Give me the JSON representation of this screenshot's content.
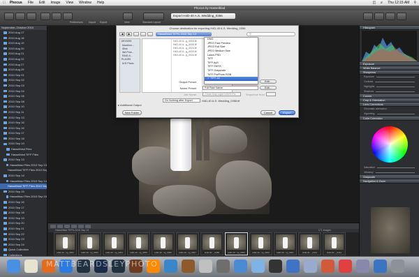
{
  "menubar": {
    "apple": "",
    "items": [
      "Phocus",
      "File",
      "Edit",
      "Image",
      "View",
      "Window",
      "Help"
    ],
    "clock": "Thu 12:15 AM"
  },
  "window": {
    "title": "Phocus by Hasselblad"
  },
  "toolbar": {
    "labels": [
      "Preferences",
      "Import",
      "Export"
    ],
    "view_label": "View",
    "mode_label": "Standard Layout",
    "export_select": "Export H4D-40 A.S. Wedding_0356"
  },
  "left_panel": {
    "header": "September–October 2010",
    "items": [
      "2010 Aug 17",
      "2010 Aug 18",
      "2010 Aug 19",
      "2010 Aug 20",
      "2010 Aug 21",
      "2010 Aug 22",
      "2010 Aug 27",
      "2010 Aug 29",
      "2010 Sep 01",
      "2010 Sep 02",
      "2010 Sep 03",
      "2010 Sep 04",
      "2010 Sep 06",
      "2010 Sep 08",
      "2010 Sep 10",
      "2010 Sep 11",
      "2010 Sep 13",
      "2010 Sep 15",
      "2010 Sep 16",
      "2010 Sep 17",
      "2010 Sep 18",
      "2010 Sep 19",
      "Hasselblad Files",
      "Hasselblad TIFF Files",
      "2010 Sep 13",
      "Hasselblad Files 2010 Sep 13",
      "Hasselblad TIFF Files 2010 Sep 13",
      "2010 Sep 14",
      "Hasselblad Files 2010 Sep 14",
      "Hasselblad TIFF Files 2010 Sep 14",
      "2010 Sep 15",
      "Hasselblad Files 2010 Sep 15",
      "2010 Sep 16",
      "2010 Sep 17",
      "2010 Sep 18",
      "2010 Sep 19",
      "2010 Sep 20",
      "2010 Sep 21",
      "2010 Sep 22",
      "2010 Sep 23",
      "2010 Sep 24",
      "Quick Collection",
      "Collections"
    ]
  },
  "dialog": {
    "title": "Choose destination for exporting H4D-40 A.S. Wedding_0356",
    "path": "Hasselblad TIFFs 2010 Sep 13",
    "search_placeholder": "",
    "sidebar": {
      "devices_header": "DEVICES",
      "devices": [
        "Macintos...",
        "iDisk",
        "WA Phot...",
        "RAID-A..."
      ],
      "places_header": "PLACES",
      "places": [
        "M.R Photo"
      ]
    },
    "files": [
      "H4D-40 A...g_0003.tif",
      "H4D-40 A...g_0005.tif",
      "H4D-40 A...g_0024.tif",
      "H4D-40 A...g_0033.tif",
      "H4D-40 A...g_0034.tif"
    ],
    "format_options": [
      "DNG",
      "JPEG Fast Preview",
      "JPEG Full Size",
      "JPEG Medium Size",
      "Lawrs PSD",
      "TIFF",
      "TIFF AyS",
      "TIFF CMYK",
      "TIFF Grayscale",
      "TIFF ProPhoto RGB",
      "TIFF-16"
    ],
    "format_selected": "TIFF-16",
    "output_preset_label": "Output Preset",
    "name_preset_label": "Name Preset",
    "name_preset_value": "Full Raw Name",
    "job_name_label": "Job Name",
    "job_name_value": "Close Day Light H/D/R Pic",
    "sequence_label": "Sequence from",
    "edit_label": "Edit...",
    "after_export": "Do Nothing after Export",
    "output_filename": "H4D-40 A.S. Wedding_0356.tif",
    "additional_output": "Additional Output",
    "new_folder": "New Folder",
    "cancel": "Cancel",
    "export": "Export"
  },
  "right_panel": {
    "sections": [
      "Histogram",
      "Exposure",
      "White Balance",
      "Sharpness",
      "Curves",
      "Crop & Orientation",
      "Lens Corrections",
      "Color Correction",
      "Grayscale",
      "Navigation & Zoom"
    ],
    "exposure_params": [
      "Exposure",
      "Contrast",
      "Highlights",
      "Shadows"
    ],
    "lens_params": [
      "Chromatic aberration",
      "Vignetting"
    ],
    "color_params": [
      "Saturation",
      "Vibrancy"
    ]
  },
  "filmstrip": {
    "folder": "Hasselblad TIFFs 2010 Sep 13",
    "count_text": "171 images",
    "thumbs": [
      "H4D-40...ng_0352",
      "H4D-40...ng_0353",
      "H4D-40...ng_0354",
      "H4D-40...ng_0355",
      "H4D-40...ng_0356",
      "H4D-40...ng_0357",
      "H4D-40..._0358",
      "H4D-40...ng_0359",
      "H4D-40...ng_0360",
      "H4D-40...ng_0361",
      "H4D-40..._0311",
      "H4D-40..._0312"
    ],
    "selected_index": 7
  },
  "watermark": "MATTBEARDSLEYPHOTO",
  "dock": {
    "icons": [
      "finder-icon",
      "itunes-icon",
      "firefox-icon",
      "safari-icon",
      "lightroom-icon",
      "photoshop-icon",
      "lightroom-icon",
      "bridge-icon",
      "calculator-icon",
      "preview-icon",
      "guitar-icon",
      "app-icon",
      "app-icon",
      "music-icon",
      "app-icon",
      "camera-icon",
      "mail-icon",
      "app-icon",
      "app-icon",
      "calendar-icon",
      "app-icon",
      "downloads-icon",
      "trash-icon"
    ],
    "colors": [
      "#4a90e2",
      "#e8e2d0",
      "#e36b1f",
      "#2d7ae0",
      "#22313f",
      "#1a2b4a",
      "#22313f",
      "#6d3b20",
      "#ff8a00",
      "#3a86c8",
      "#8c5a2b",
      "#c0c0c0",
      "#6e6e6e",
      "#4b8bd6",
      "#7fb2e5",
      "#333333",
      "#3f73c6",
      "#9ac",
      "#d05a3a",
      "#e04040",
      "#8888aa",
      "#3b74c2",
      "#8e9196"
    ]
  },
  "accent": "#3d69b0"
}
